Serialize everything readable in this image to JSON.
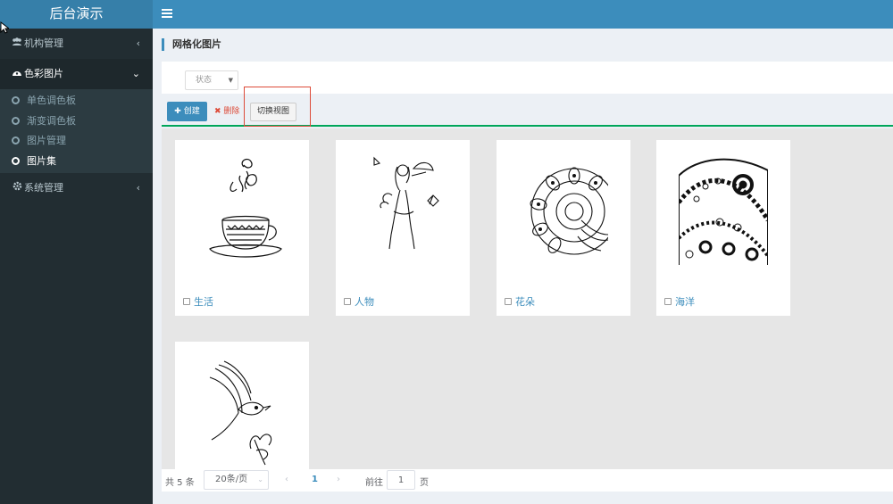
{
  "app": {
    "title": "后台演示"
  },
  "header": {
    "menu_toggle_icon": "hamburger-icon"
  },
  "sidebar": {
    "menus": [
      {
        "label": "机构管理",
        "icon": "users-icon",
        "expanded": false
      },
      {
        "label": "色彩图片",
        "icon": "palette-icon",
        "expanded": true,
        "children": [
          {
            "label": "单色调色板",
            "active": false
          },
          {
            "label": "渐变调色板",
            "active": false
          },
          {
            "label": "图片管理",
            "active": false
          },
          {
            "label": "图片集",
            "active": true
          }
        ]
      },
      {
        "label": "系统管理",
        "icon": "gear-icon",
        "expanded": false
      }
    ]
  },
  "page": {
    "title": "网格化图片"
  },
  "filter": {
    "status_placeholder": "状态"
  },
  "toolbar": {
    "create_label": "创建",
    "delete_label": "删除",
    "switch_label": "切换视图"
  },
  "cards": [
    {
      "name": "生活",
      "image": "coffee-cup-line-art"
    },
    {
      "name": "人物",
      "image": "woman-with-parasol-line-art"
    },
    {
      "name": "花朵",
      "image": "mandala-flower-line-art"
    },
    {
      "name": "海洋",
      "image": "ocean-pattern-line-art"
    },
    {
      "name": "",
      "image": "bird-and-flower-line-art"
    }
  ],
  "pagination": {
    "total": "共 5 条",
    "page_size": "20条/页",
    "current": "1",
    "goto_label": "前往",
    "goto_value": "1",
    "unit": "页"
  },
  "colors": {
    "header": "#3c8dbc",
    "logo": "#367fa9",
    "sidebar": "#222d32",
    "accent_line": "#00a65a",
    "danger": "#dd4b39"
  }
}
